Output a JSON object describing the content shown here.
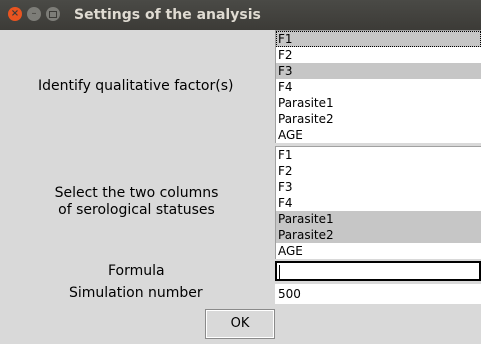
{
  "window": {
    "title": "Settings of the analysis"
  },
  "qualitative": {
    "label": "Identify qualitative factor(s)",
    "items": [
      {
        "label": "F1",
        "selected": true
      },
      {
        "label": "F2",
        "selected": false
      },
      {
        "label": "F3",
        "selected": true
      },
      {
        "label": "F4",
        "selected": false
      },
      {
        "label": "Parasite1",
        "selected": false
      },
      {
        "label": "Parasite2",
        "selected": false
      },
      {
        "label": "AGE",
        "selected": false
      }
    ]
  },
  "serological": {
    "label_line1": "Select the two columns",
    "label_line2": "of serological statuses",
    "items": [
      {
        "label": "F1",
        "selected": false
      },
      {
        "label": "F2",
        "selected": false
      },
      {
        "label": "F3",
        "selected": false
      },
      {
        "label": "F4",
        "selected": false
      },
      {
        "label": "Parasite1",
        "selected": true
      },
      {
        "label": "Parasite2",
        "selected": true
      },
      {
        "label": "AGE",
        "selected": false
      }
    ]
  },
  "formula": {
    "label": "Formula",
    "value": ""
  },
  "simulation": {
    "label": "Simulation number",
    "value": "500"
  },
  "ok_button": {
    "label": "OK"
  },
  "colors": {
    "selection": "#c6c6c6",
    "close_button": "#e95420",
    "titlebar": "#3c3b37"
  }
}
